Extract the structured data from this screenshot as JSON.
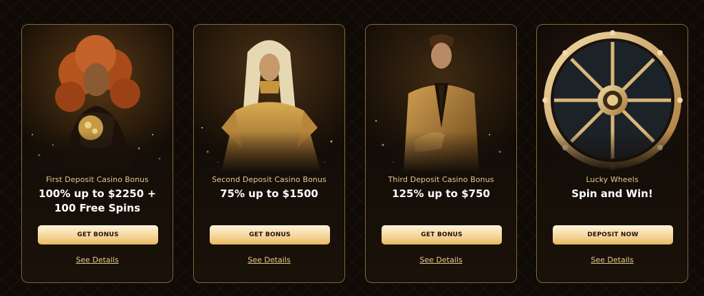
{
  "cards": [
    {
      "subtitle": "First Deposit Casino Bonus",
      "headline_line1": "100% up to $2250 +",
      "headline_line2": "100 Free Spins",
      "button": "GET BONUS",
      "details": "See Details",
      "image_icon": "woman-red-hair-gold-icon"
    },
    {
      "subtitle": "Second Deposit Casino Bonus",
      "headline_line1": "75% up to $1500",
      "headline_line2": "",
      "button": "GET BONUS",
      "details": "See Details",
      "image_icon": "woman-blonde-gold-dress-icon"
    },
    {
      "subtitle": "Third Deposit Casino Bonus",
      "headline_line1": "125% up to $750",
      "headline_line2": "",
      "button": "GET BONUS",
      "details": "See Details",
      "image_icon": "man-gold-suit-icon"
    },
    {
      "subtitle": "Lucky Wheels",
      "headline_line1": "Spin and Win!",
      "headline_line2": "",
      "button": "DEPOSIT NOW",
      "details": "See Details",
      "image_icon": "fortune-wheel-icon"
    }
  ],
  "colors": {
    "accent_gold": "#e8c98d",
    "button_gradient_top": "#fff3da",
    "button_gradient_bottom": "#e7b964",
    "card_border": "#8a6a3a",
    "background": "#0f0a06"
  }
}
